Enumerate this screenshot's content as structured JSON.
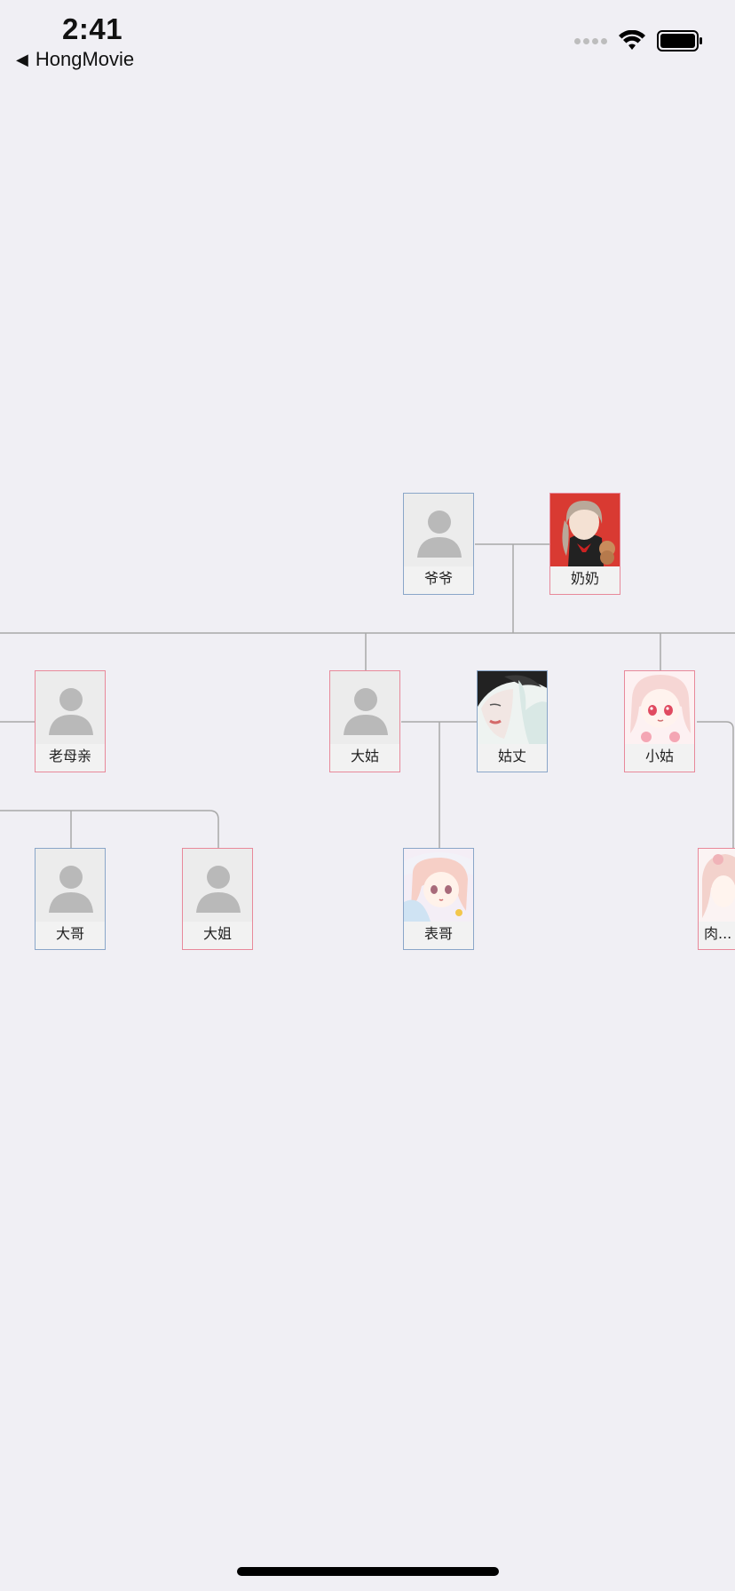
{
  "status_bar": {
    "time": "2:41",
    "back_label": "HongMovie"
  },
  "tree": {
    "grandfather": "爷爷",
    "grandmother": "奶奶",
    "mother": "老母亲",
    "aunt_eldest": "大姑",
    "aunt_eldest_husband": "姑丈",
    "aunt_youngest": "小姑",
    "elder_brother": "大哥",
    "elder_sister": "大姐",
    "cousin": "表哥",
    "cut_off_child": "肉..."
  },
  "colors": {
    "male_border": "#8aa6c8",
    "female_border": "#e8899a",
    "background": "#f0eff4",
    "line": "#a8a8a8"
  }
}
